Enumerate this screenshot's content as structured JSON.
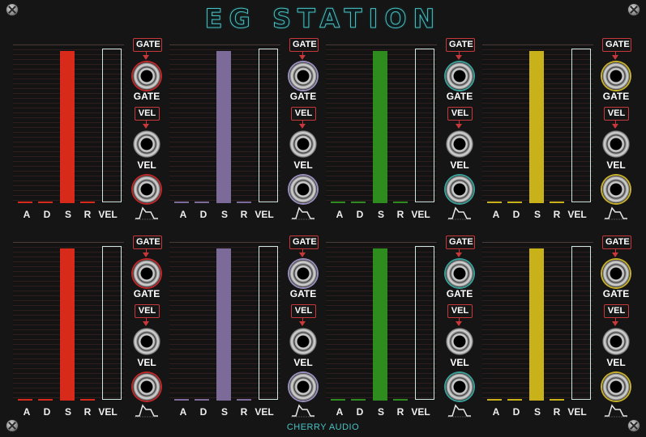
{
  "title": "EG STATION",
  "brand": "CHERRY AUDIO",
  "labels": {
    "a": "A",
    "d": "D",
    "s": "S",
    "r": "R",
    "vel": "VEL",
    "gate_tag": "GATE",
    "vel_tag": "VEL",
    "gate_jack": "GATE",
    "vel_jack": "VEL"
  },
  "modules": [
    {
      "color": "#d72a1a",
      "rim": "#c0282a",
      "levels": {
        "a": 0.01,
        "d": 0.01,
        "s": 1.0,
        "r": 0.01
      }
    },
    {
      "color": "#7c6a98",
      "rim": "#9a8fbf",
      "levels": {
        "a": 0.01,
        "d": 0.01,
        "s": 1.0,
        "r": 0.01
      }
    },
    {
      "color": "#2e8b1e",
      "rim": "#3aa29a",
      "levels": {
        "a": 0.01,
        "d": 0.01,
        "s": 1.0,
        "r": 0.01
      }
    },
    {
      "color": "#c9b11a",
      "rim": "#c7b12b",
      "levels": {
        "a": 0.01,
        "d": 0.01,
        "s": 1.0,
        "r": 0.01
      }
    },
    {
      "color": "#d72a1a",
      "rim": "#c0282a",
      "levels": {
        "a": 0.01,
        "d": 0.01,
        "s": 1.0,
        "r": 0.01
      }
    },
    {
      "color": "#7c6a98",
      "rim": "#9a8fbf",
      "levels": {
        "a": 0.01,
        "d": 0.01,
        "s": 1.0,
        "r": 0.01
      }
    },
    {
      "color": "#2e8b1e",
      "rim": "#3aa29a",
      "levels": {
        "a": 0.01,
        "d": 0.01,
        "s": 1.0,
        "r": 0.01
      }
    },
    {
      "color": "#c9b11a",
      "rim": "#c7b12b",
      "levels": {
        "a": 0.01,
        "d": 0.01,
        "s": 1.0,
        "r": 0.01
      }
    }
  ]
}
